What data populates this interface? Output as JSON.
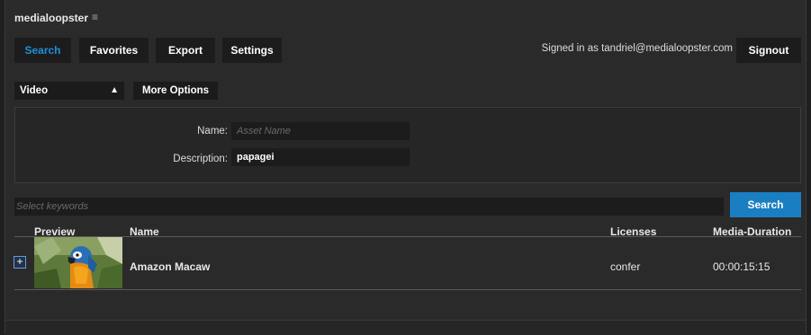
{
  "app": {
    "title": "medialoopster",
    "menu_icon": "hamburger-icon"
  },
  "tabs": [
    {
      "label": "Search",
      "active": true
    },
    {
      "label": "Favorites",
      "active": false
    },
    {
      "label": "Export",
      "active": false
    },
    {
      "label": "Settings",
      "active": false
    }
  ],
  "user": {
    "signed_in_text": "Signed in as tandriel@medialoopster.com",
    "signout_label": "Signout"
  },
  "filters": {
    "media_type": "Video",
    "more_options_label": "More Options"
  },
  "form": {
    "name_label": "Name:",
    "name_placeholder": "Asset Name",
    "name_value": "",
    "description_label": "Description:",
    "description_value": "papagei"
  },
  "keywords": {
    "placeholder": "Select keywords"
  },
  "search_button": "Search",
  "table": {
    "headers": {
      "preview": "Preview",
      "name": "Name",
      "licenses": "Licenses",
      "duration": "Media-Duration"
    },
    "rows": [
      {
        "expand_icon": "plus-icon",
        "preview": "parrot-thumbnail",
        "name": "Amazon Macaw",
        "licenses": "confer",
        "duration": "00:00:15:15"
      }
    ]
  },
  "colors": {
    "accent": "#1a7ec2",
    "active_tab_text": "#1e90d8",
    "background": "#2a2a2a"
  }
}
